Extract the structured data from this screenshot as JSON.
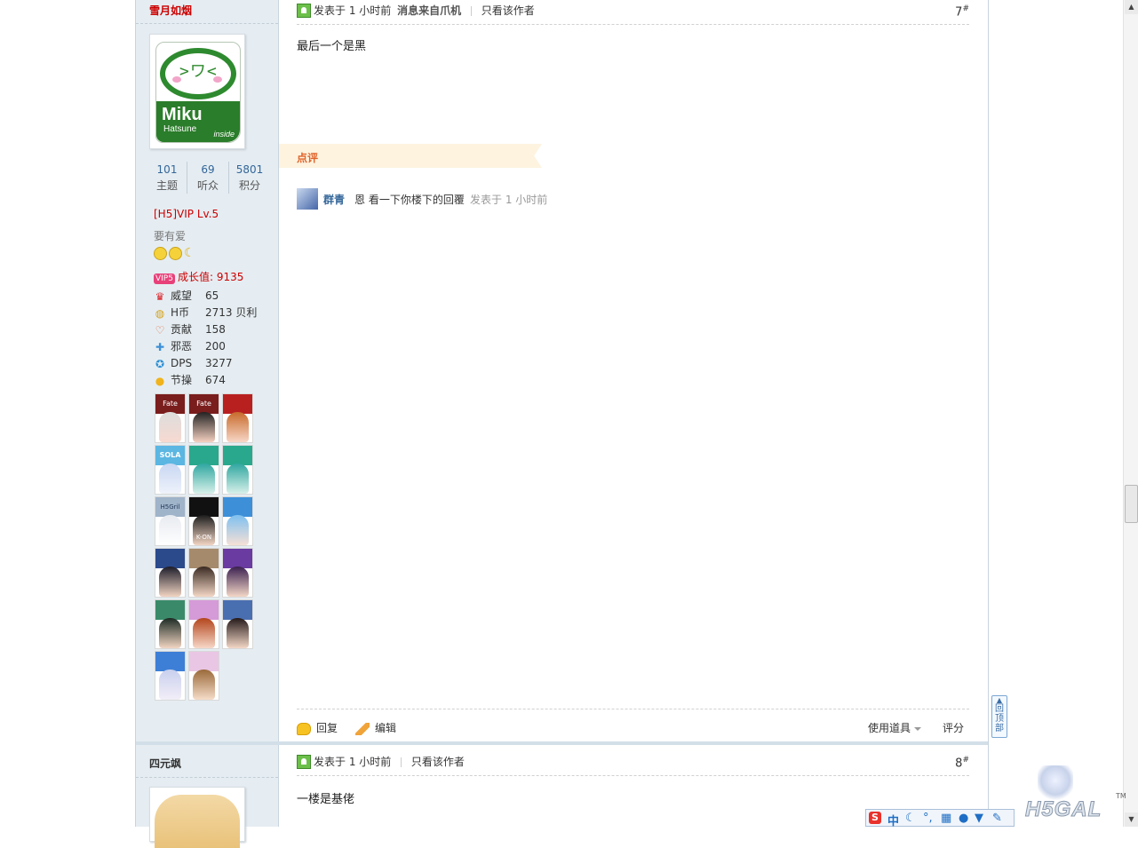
{
  "post1": {
    "author": "雪月如烟",
    "stats": [
      {
        "num": "101",
        "label": "主题"
      },
      {
        "num": "69",
        "label": "听众"
      },
      {
        "num": "5801",
        "label": "积分"
      }
    ],
    "vip_level": "[H5]VIP Lv.5",
    "motto": "要有爱",
    "growth_badge": "VIP5",
    "growth": "成长值: 9135",
    "attributes": [
      {
        "icon": "crown-icon",
        "key": "威望",
        "value": "65"
      },
      {
        "icon": "coin-icon",
        "key": "H币",
        "value": "2713 贝利"
      },
      {
        "icon": "heart-icon",
        "key": "贡献",
        "value": "158"
      },
      {
        "icon": "puzzle-icon",
        "key": "邪恶",
        "value": "200"
      },
      {
        "icon": "star-icon",
        "key": "DPS",
        "value": "3277"
      },
      {
        "icon": "bulb-icon",
        "key": "节操",
        "value": "674"
      }
    ],
    "avatar_text": {
      "title": "Miku",
      "sub": "Hatsune",
      "inside": "inside",
      "face": ">ワ<"
    },
    "medal_labels": [
      "Fate",
      "Fate",
      "SOLA",
      "H5Gril",
      "K-ON"
    ],
    "head": {
      "posted": "发表于 1 小时前",
      "from": "消息来自爪机",
      "only_author": "只看该作者",
      "floor": "7",
      "floor_mark": "#"
    },
    "content": "最后一个是黑",
    "comment_tab": "点评",
    "comment": {
      "author": "群青",
      "text": "恩 看一下你楼下的回覆",
      "time": "发表于 1 小时前"
    },
    "actions": {
      "reply": "回复",
      "edit": "编辑",
      "tools": "使用道具",
      "rate": "评分"
    }
  },
  "post2": {
    "author": "四元飒",
    "head": {
      "posted": "发表于 1 小时前",
      "only_author": "只看该作者",
      "floor": "8",
      "floor_mark": "#"
    },
    "content": "一楼是基佬"
  },
  "backtop": {
    "label": "回顶部"
  },
  "logo": {
    "text": "H5GAL",
    "tm": "TM"
  },
  "ime": {
    "mode": "中"
  },
  "colors": {
    "name_red": "#cc0000",
    "link_blue": "#336699",
    "comment_orange": "#e0632a",
    "side_bg": "#e5edf2"
  }
}
